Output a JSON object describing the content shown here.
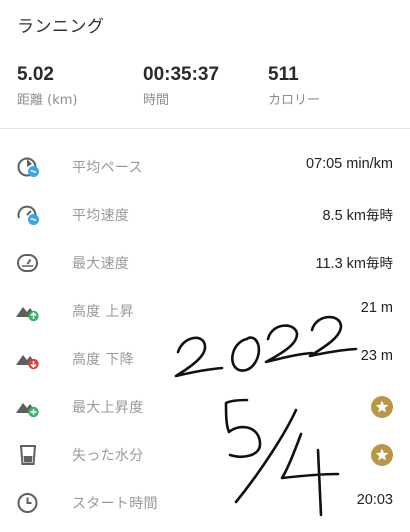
{
  "header": {
    "title": "ランニング"
  },
  "summary": [
    {
      "value": "5.02",
      "label": "距離 (km)"
    },
    {
      "value": "00:35:37",
      "label": "時間"
    },
    {
      "value": "511",
      "label": "カロリー"
    }
  ],
  "rows": [
    {
      "icon": "pace-gauge-icon",
      "label": "平均ペース",
      "value": "07:05 min/km"
    },
    {
      "icon": "speed-gauge-icon",
      "label": "平均速度",
      "value": "8.5 km",
      "unit": "毎時"
    },
    {
      "icon": "speedometer-icon",
      "label": "最大速度",
      "value": "11.3 km",
      "unit": "毎時"
    },
    {
      "icon": "elevation-up-icon",
      "label": "高度 上昇",
      "value": "21 m"
    },
    {
      "icon": "elevation-down-icon",
      "label": "高度 下降",
      "value": "23 m"
    },
    {
      "icon": "max-elevation-icon",
      "label": "最大上昇度",
      "value": ""
    },
    {
      "icon": "water-glass-icon",
      "label": "失った水分",
      "value": ""
    },
    {
      "icon": "clock-icon",
      "label": "スタート時間",
      "value": "20:03"
    }
  ],
  "handwriting": {
    "year": "2022",
    "date": "5/4"
  },
  "colors": {
    "accent_blue": "#3aa7e0",
    "up_green": "#3bb36a",
    "down_red": "#d9413b",
    "star_gold": "#b8964a",
    "icon_gray": "#5f5f5f"
  }
}
